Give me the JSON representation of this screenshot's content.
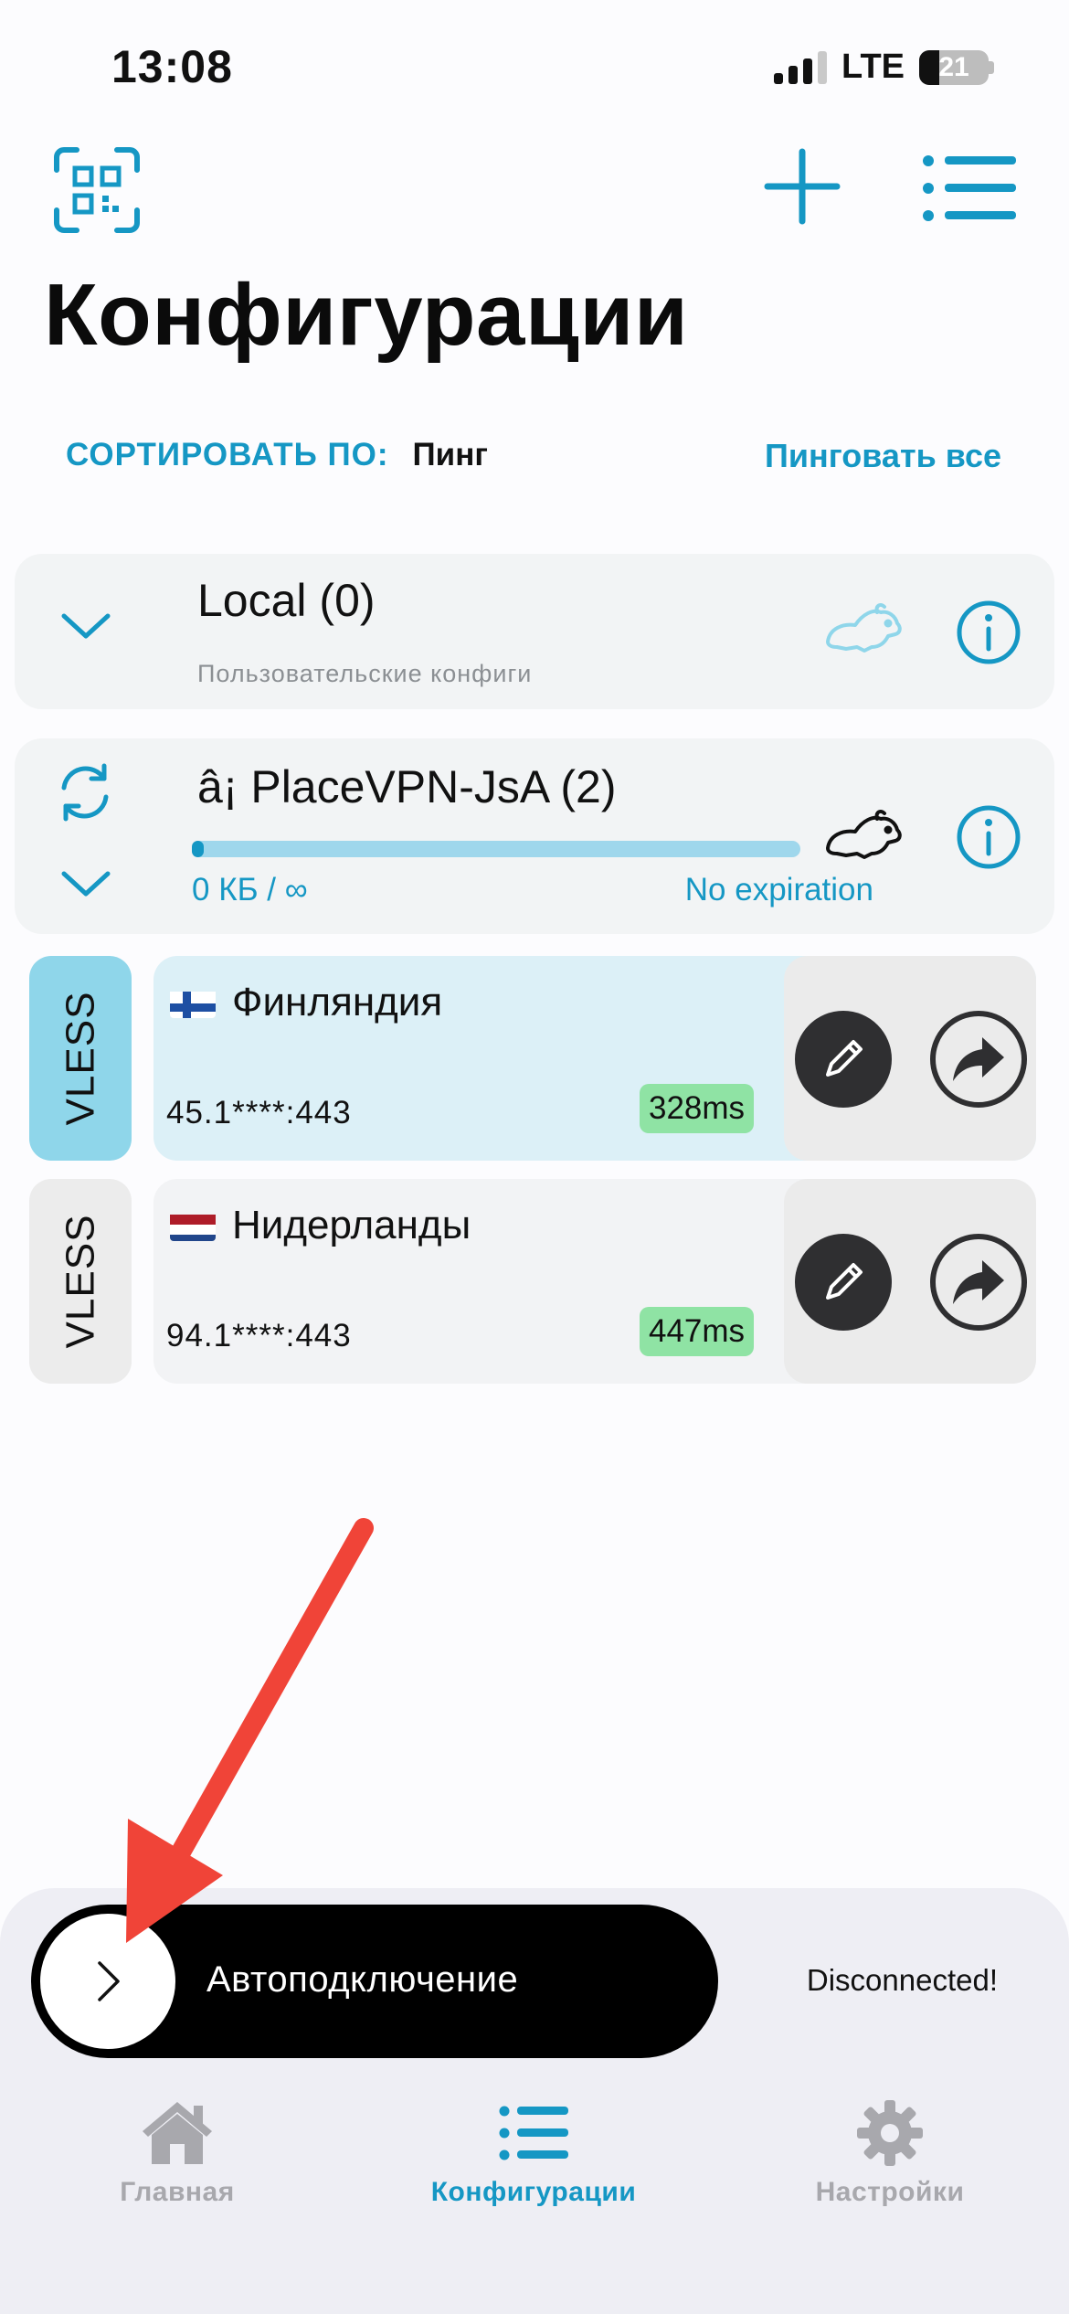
{
  "status_bar": {
    "time": "13:08",
    "network": "LTE",
    "battery": "21"
  },
  "toolbar": {
    "qr_icon": "qr-scan-icon",
    "add_icon": "plus-icon",
    "menu_icon": "list-icon"
  },
  "page": {
    "title": "Конфигурации"
  },
  "sort": {
    "label": "СОРТИРОВАТЬ ПО:",
    "value": "Пинг",
    "ping_all": "Пинговать все"
  },
  "groups": [
    {
      "title": "Local (0)",
      "subtitle": "Пользовательские конфиги"
    },
    {
      "title": "â¡ PlaceVPN-JsA (2)",
      "usage": "0 КБ / ∞",
      "expiry": "No expiration",
      "progress_fraction": 0.02
    }
  ],
  "configs": [
    {
      "protocol": "VLESS",
      "flag": "finland-flag-icon",
      "name": "Финляндия",
      "address": "45.1****:443",
      "ping": "328ms",
      "selected": true
    },
    {
      "protocol": "VLESS",
      "flag": "netherlands-flag-icon",
      "name": "Нидерланды",
      "address": "94.1****:443",
      "ping": "447ms",
      "selected": false
    }
  ],
  "connect": {
    "toggle_label": "Автоподключение",
    "status": "Disconnected!"
  },
  "tabs": [
    {
      "label": "Главная",
      "icon": "home-icon",
      "active": false
    },
    {
      "label": "Конфигурации",
      "icon": "list-icon",
      "active": true
    },
    {
      "label": "Настройки",
      "icon": "gear-icon",
      "active": false
    }
  ],
  "colors": {
    "accent": "#1597c4",
    "selected_tab": "#8fd6ea",
    "ping_badge": "#8fe3a4",
    "annotation_arrow": "#f04438"
  }
}
